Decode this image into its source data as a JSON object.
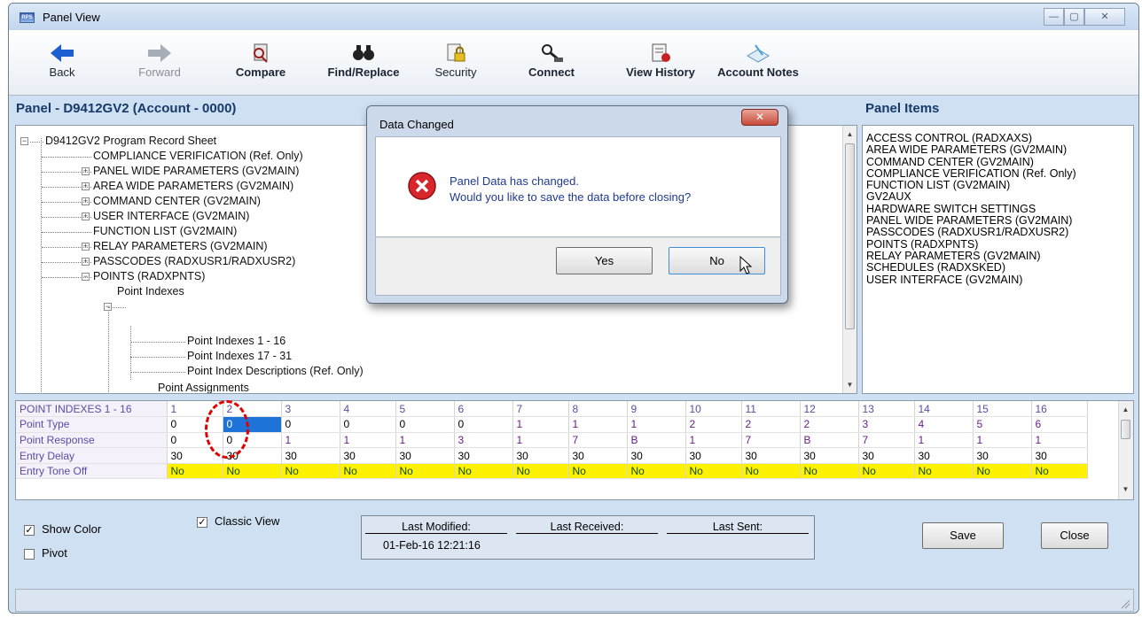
{
  "window": {
    "title": "Panel View",
    "app_icon_text": "RPS"
  },
  "toolbar": {
    "back": "Back",
    "forward": "Forward",
    "compare": "Compare",
    "find_replace": "Find/Replace",
    "security": "Security",
    "connect": "Connect",
    "view_history": "View History",
    "account_notes": "Account Notes"
  },
  "panel": {
    "title": "Panel - D9412GV2 (Account - 0000)"
  },
  "panel_items": {
    "title": "Panel Items",
    "items": [
      "ACCESS CONTROL (RADXAXS)",
      "AREA WIDE PARAMETERS (GV2MAIN)",
      "COMMAND CENTER (GV2MAIN)",
      "COMPLIANCE VERIFICATION (Ref. Only)",
      "FUNCTION LIST (GV2MAIN)",
      "GV2AUX",
      "HARDWARE SWITCH SETTINGS",
      "PANEL WIDE PARAMETERS (GV2MAIN)",
      "PASSCODES (RADXUSR1/RADXUSR2)",
      "POINTS (RADXPNTS)",
      "RELAY PARAMETERS (GV2MAIN)",
      "SCHEDULES (RADXSKED)",
      "USER INTERFACE (GV2MAIN)"
    ]
  },
  "tree": {
    "root": "D9412GV2 Program Record Sheet",
    "compliance": "COMPLIANCE VERIFICATION (Ref. Only)",
    "panel_wide": "PANEL WIDE PARAMETERS (GV2MAIN)",
    "area_wide": "AREA WIDE PARAMETERS (GV2MAIN)",
    "command_center": "COMMAND CENTER (GV2MAIN)",
    "user_interface": "USER INTERFACE (GV2MAIN)",
    "function_list": "FUNCTION LIST (GV2MAIN)",
    "relay": "RELAY PARAMETERS (GV2MAIN)",
    "passcodes": "PASSCODES (RADXUSR1/RADXUSR2)",
    "points": "POINTS (RADXPNTS)",
    "point_indexes": "Point Indexes",
    "pi_1_16": "Point Indexes 1 - 16",
    "pi_17_31": "Point Indexes 17 - 31",
    "pi_desc": "Point Index Descriptions (Ref. Only)",
    "point_assignments": "Point Assignments"
  },
  "grid": {
    "header": [
      "POINT INDEXES 1 - 16",
      "1",
      "2",
      "3",
      "4",
      "5",
      "6",
      "7",
      "8",
      "9",
      "10",
      "11",
      "12",
      "13",
      "14",
      "15",
      "16"
    ],
    "rows": [
      {
        "label": "Point Type",
        "values": [
          "0",
          "0",
          "0",
          "0",
          "0",
          "0",
          "1",
          "1",
          "1",
          "2",
          "2",
          "2",
          "3",
          "4",
          "5",
          "6"
        ]
      },
      {
        "label": "Point Response",
        "values": [
          "0",
          "0",
          "1",
          "1",
          "1",
          "3",
          "1",
          "7",
          "B",
          "1",
          "7",
          "B",
          "7",
          "1",
          "1",
          "1"
        ]
      },
      {
        "label": "Entry Delay",
        "values": [
          "30",
          "30",
          "30",
          "30",
          "30",
          "30",
          "30",
          "30",
          "30",
          "30",
          "30",
          "30",
          "30",
          "30",
          "30",
          "30"
        ]
      },
      {
        "label": "Entry Tone Off",
        "values": [
          "No",
          "No",
          "No",
          "No",
          "No",
          "No",
          "No",
          "No",
          "No",
          "No",
          "No",
          "No",
          "No",
          "No",
          "No",
          "No"
        ]
      }
    ]
  },
  "options": {
    "show_color": "Show Color",
    "pivot": "Pivot",
    "classic_view": "Classic View",
    "checked_mark": "✓"
  },
  "status": {
    "last_modified_label": "Last Modified:",
    "last_modified_value": "01-Feb-16 12:21:16",
    "last_received_label": "Last Received:",
    "last_sent_label": "Last Sent:"
  },
  "buttons": {
    "save": "Save",
    "close": "Close"
  },
  "dialog": {
    "title": "Data Changed",
    "line1": "Panel Data has changed.",
    "line2": "Would you like to save the data before closing?",
    "yes": "Yes",
    "no": "No"
  },
  "colors": {
    "accent": "#1e73d8",
    "highlight_row": "#fff200",
    "annotation": "#e00000"
  }
}
